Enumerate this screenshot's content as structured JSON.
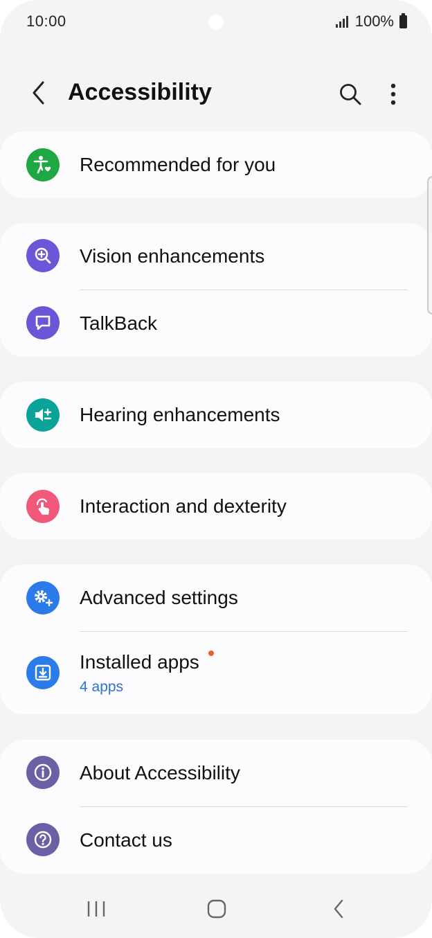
{
  "status_bar": {
    "time": "10:00",
    "battery": "100%"
  },
  "header": {
    "title": "Accessibility"
  },
  "icons": {
    "back": "back-arrow-icon",
    "search": "search-icon",
    "more": "more-vertical-icon"
  },
  "groups": [
    {
      "items": [
        {
          "label": "Recommended for you",
          "icon": "accessibility-person-icon",
          "color": "#1fa743"
        }
      ]
    },
    {
      "items": [
        {
          "label": "Vision enhancements",
          "icon": "magnify-plus-icon",
          "color": "#6d55d8"
        },
        {
          "label": "TalkBack",
          "icon": "speech-bubble-icon",
          "color": "#6d55d8"
        }
      ]
    },
    {
      "items": [
        {
          "label": "Hearing enhancements",
          "icon": "volume-plus-minus-icon",
          "color": "#0aa39a"
        }
      ]
    },
    {
      "items": [
        {
          "label": "Interaction and dexterity",
          "icon": "touch-hand-icon",
          "color": "#f0597a"
        }
      ]
    },
    {
      "items": [
        {
          "label": "Advanced settings",
          "icon": "gear-plus-icon",
          "color": "#2b7be8"
        },
        {
          "label": "Installed apps",
          "sublabel": "4 apps",
          "icon": "download-box-icon",
          "color": "#2b7be8",
          "has_new_badge": true
        }
      ]
    },
    {
      "items": [
        {
          "label": "About Accessibility",
          "icon": "info-icon",
          "color": "#6a61a5"
        },
        {
          "label": "Contact us",
          "icon": "question-icon",
          "color": "#6a61a5"
        }
      ]
    }
  ],
  "nav_bar": {
    "recents": "recent-apps-icon",
    "home": "home-icon",
    "back": "nav-back-icon"
  }
}
